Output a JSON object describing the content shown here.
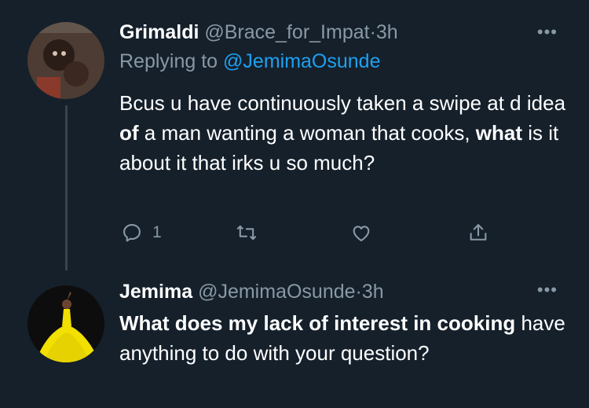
{
  "tweet1": {
    "display_name": "Grimaldi",
    "handle": "@Brace_for_Impat",
    "separator": "·",
    "time": "3h",
    "replying_prefix": "Replying to",
    "replying_to": "@JemimaOsunde",
    "body_parts": [
      "Bcus u have continuously taken a swipe at d idea ",
      "of",
      " a man wanting a woman that cooks, ",
      "what",
      " is it about it that irks u so much?"
    ],
    "reply_count": "1",
    "more": "•••"
  },
  "tweet2": {
    "display_name": "Jemima",
    "handle": "@JemimaOsunde",
    "separator": "·",
    "time": "3h",
    "body_parts": [
      "What does my lack of interest in cooking",
      " have anything to do with your question?"
    ],
    "more": "•••"
  },
  "colors": {
    "background": "#15202b",
    "muted": "#8899a6",
    "link": "#1da1f2",
    "text": "#ffffff"
  },
  "icons": [
    "reply-icon",
    "retweet-icon",
    "like-icon",
    "share-icon",
    "more-icon"
  ]
}
